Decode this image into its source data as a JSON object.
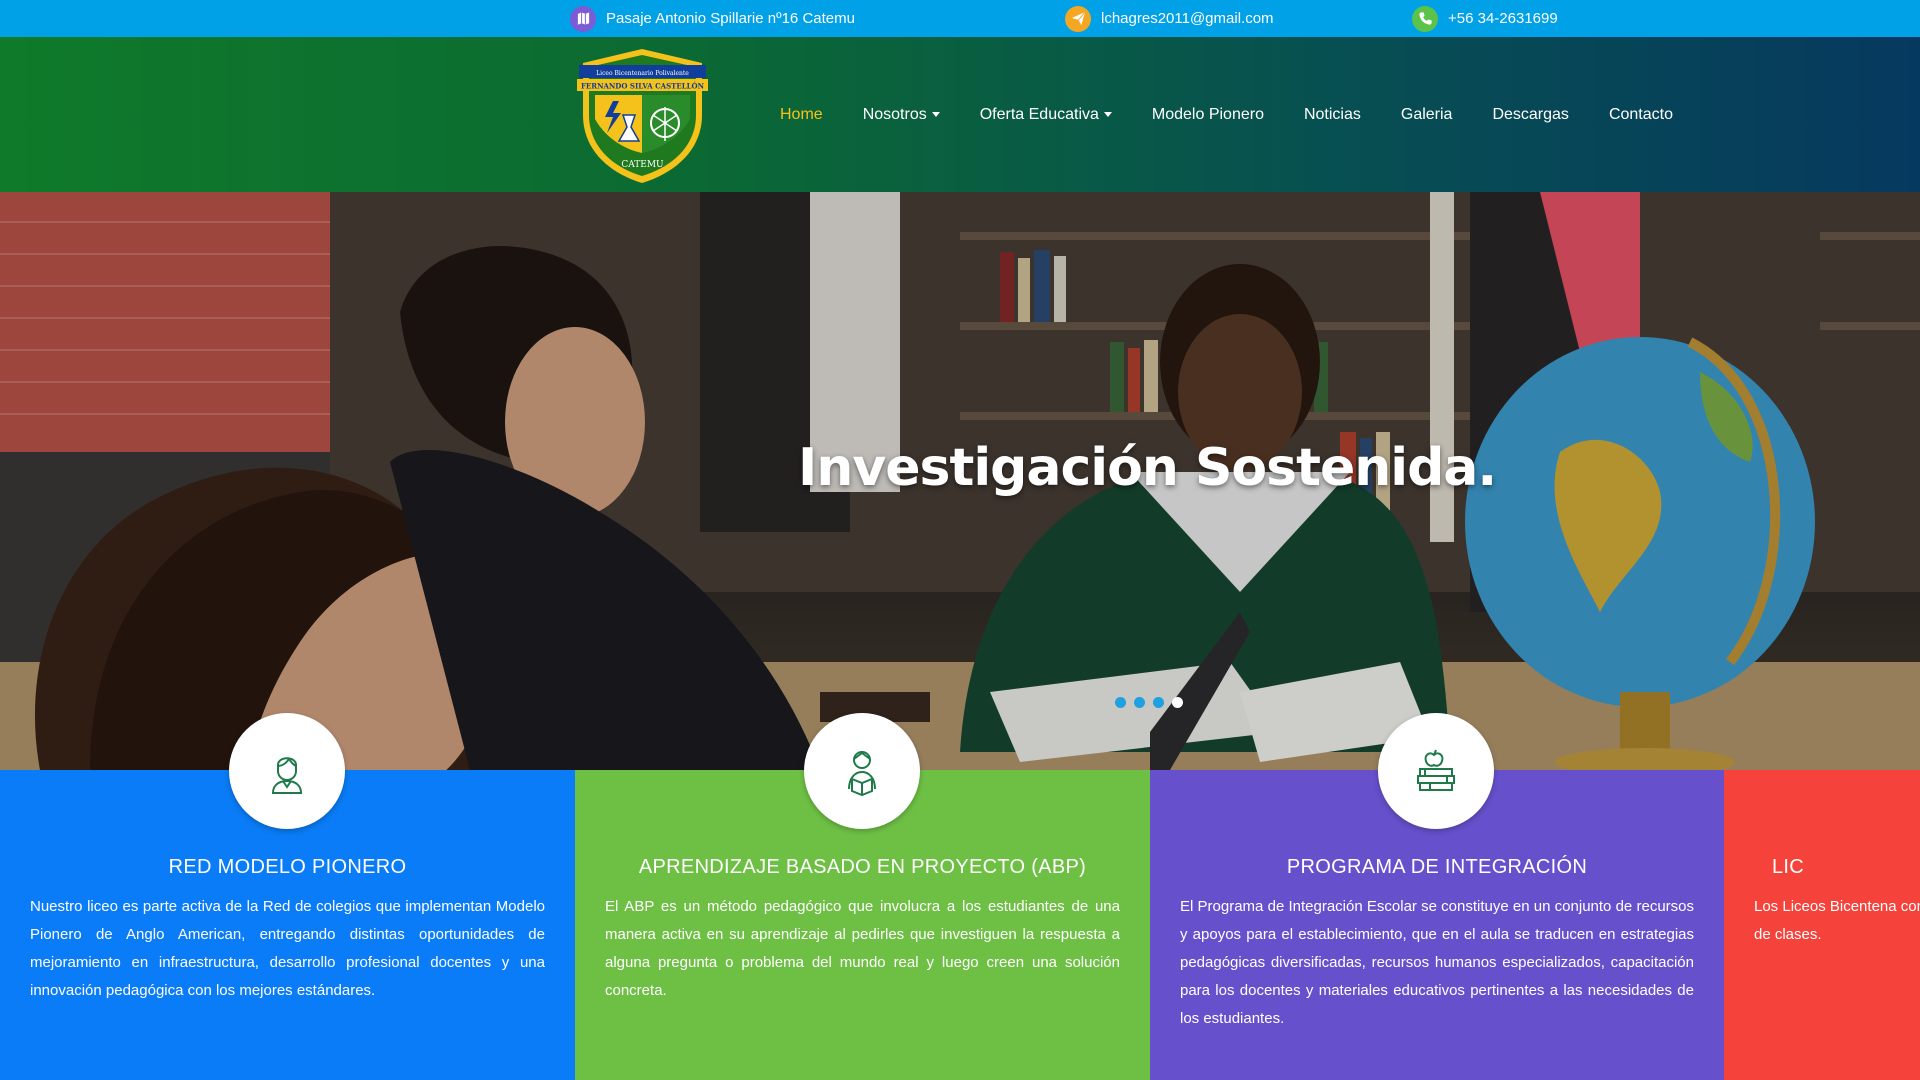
{
  "topbar": {
    "address": "Pasaje Antonio Spillarie nº16 Catemu",
    "email": "lchagres2011@gmail.com",
    "phone": "+56 34-2631699",
    "icons": [
      "map-icon",
      "send-icon",
      "phone-icon"
    ],
    "icon_colors": [
      "#7b5cd6",
      "#f5a623",
      "#5cc34a"
    ]
  },
  "logo": {
    "line1": "Liceo Bicentenario Polivalente",
    "line2": "FERNANDO SILVA CASTELLÓN",
    "line3": "CATEMU"
  },
  "nav": {
    "items": [
      {
        "label": "Home",
        "active": true,
        "dropdown": false
      },
      {
        "label": "Nosotros",
        "active": false,
        "dropdown": true
      },
      {
        "label": "Oferta Educativa",
        "active": false,
        "dropdown": true
      },
      {
        "label": "Modelo Pionero",
        "active": false,
        "dropdown": false
      },
      {
        "label": "Noticias",
        "active": false,
        "dropdown": false
      },
      {
        "label": "Galeria",
        "active": false,
        "dropdown": false
      },
      {
        "label": "Descargas",
        "active": false,
        "dropdown": false
      },
      {
        "label": "Contacto",
        "active": false,
        "dropdown": false
      }
    ]
  },
  "hero": {
    "title": "Investigación Sostenida.",
    "slides": 4,
    "active_slide": 4
  },
  "cards": [
    {
      "title": "RED MODELO PIONERO",
      "text": "Nuestro liceo es parte activa de la Red de colegios que implementan Modelo Pionero de Anglo American, entregando distintas oportunidades de mejoramiento en infraestructura, desarrollo profesional docentes y una innovación pedagógica con los mejores estándares.",
      "color": "#0a7cf7",
      "icon": "teacher-icon"
    },
    {
      "title": "APRENDIZAJE BASADO EN PROYECTO (ABP)",
      "text": "El ABP es un método pedagógico que involucra a los estudiantes de una manera activa en su aprendizaje al pedirles que investiguen la respuesta a alguna pregunta o problema del mundo real y luego creen una solución concreta.",
      "color": "#6ec045",
      "icon": "student-reading-icon"
    },
    {
      "title": "PROGRAMA DE INTEGRACIÓN",
      "text": "El Programa de Integración Escolar se constituye en un conjunto de recursos y apoyos para el establecimiento, que en el aula se traducen en estrategias pedagógicas diversificadas, recursos humanos especializados, capacitación para los docentes y materiales educativos pertinentes a las necesidades de los estudiantes.",
      "color": "#6750cc",
      "icon": "books-apple-icon"
    },
    {
      "title": "LIC",
      "text": "Los Liceos Bicentena comparten tres prin educación de calidad y en la sala de clases.",
      "color": "#f5423a",
      "icon": ""
    }
  ]
}
